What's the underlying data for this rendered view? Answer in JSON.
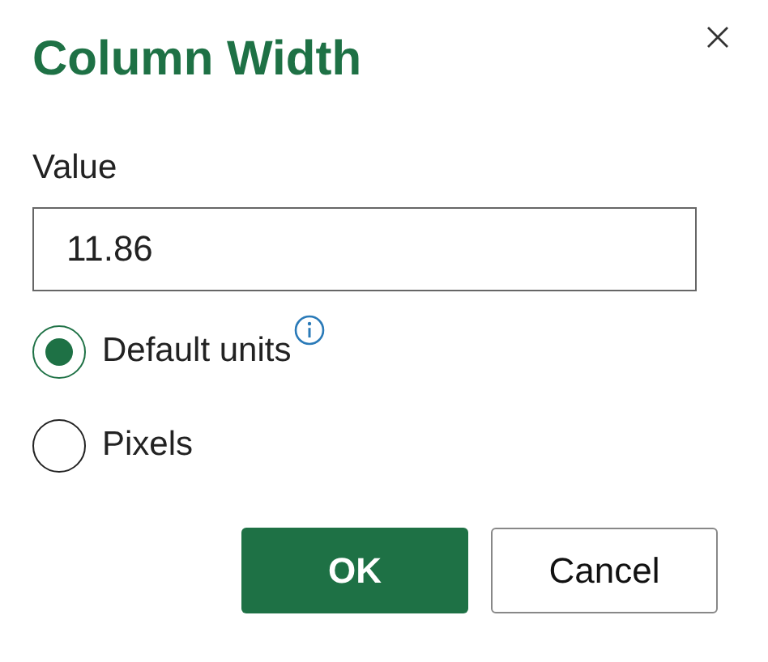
{
  "dialog": {
    "title": "Column Width"
  },
  "value_field": {
    "label": "Value",
    "value": "11.86"
  },
  "units": [
    {
      "label": "Default units",
      "selected": true,
      "info": true
    },
    {
      "label": "Pixels",
      "selected": false,
      "info": false
    }
  ],
  "buttons": [
    {
      "label": "OK",
      "kind": "primary"
    },
    {
      "label": "Cancel",
      "kind": "secondary"
    }
  ]
}
